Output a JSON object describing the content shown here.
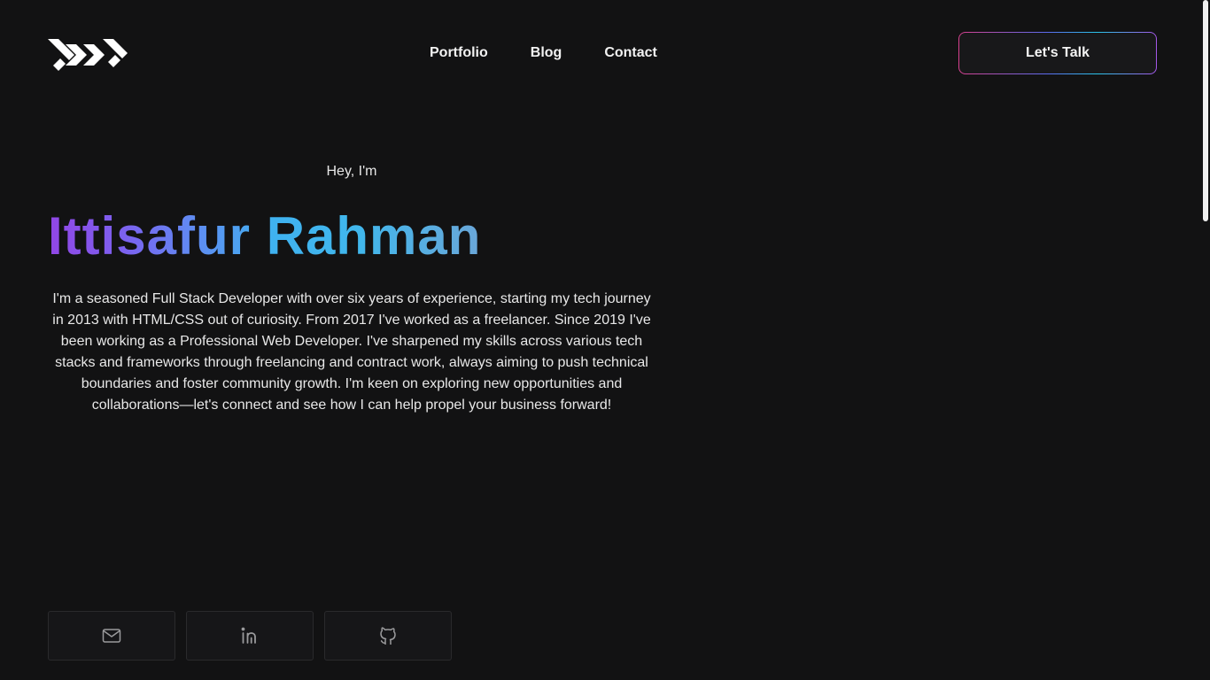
{
  "header": {
    "logo_icon": "chevrons-logo-icon",
    "nav": [
      {
        "label": "Portfolio"
      },
      {
        "label": "Blog"
      },
      {
        "label": "Contact"
      }
    ],
    "cta_label": "Let's Talk"
  },
  "hero": {
    "greeting": "Hey, I'm",
    "name": "Ittisafur Rahman",
    "bio": "I'm a seasoned Full Stack Developer with over six years of experience, starting my tech journey in 2013 with HTML/CSS out of curiosity. From 2017 I've worked as a freelancer. Since 2019 I've been working as a Professional Web Developer. I've sharpened my skills across various tech stacks and frameworks through freelancing and contract work, always aiming to push technical boundaries and foster community growth. I'm keen on exploring new opportunities and collaborations—let's connect and see how I can help propel your business forward!"
  },
  "socials": [
    {
      "icon": "mail-icon"
    },
    {
      "icon": "linkedin-icon"
    },
    {
      "icon": "github-icon"
    }
  ],
  "colors": {
    "background": "#121213",
    "name_gradient": [
      "#9146e6",
      "#5f8cf2",
      "#41b7ec",
      "#6aa6d8"
    ],
    "cta_border_gradient": [
      "#d6408e",
      "#5b6cf0",
      "#29c4e8",
      "#a557e8"
    ]
  }
}
